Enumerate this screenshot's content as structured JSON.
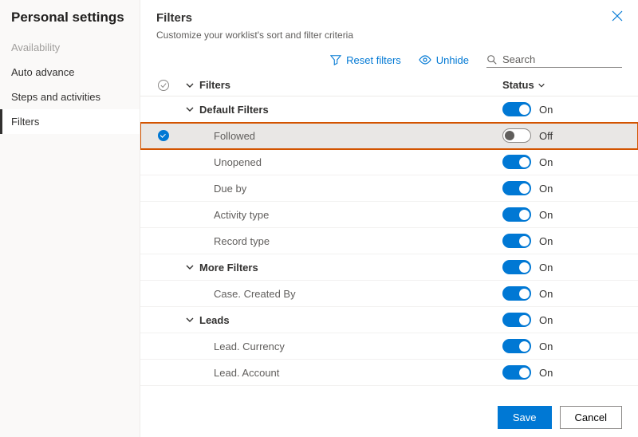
{
  "sidebar": {
    "title": "Personal settings",
    "items": [
      {
        "label": "Availability",
        "disabled": true
      },
      {
        "label": "Auto advance"
      },
      {
        "label": "Steps and activities"
      },
      {
        "label": "Filters",
        "selected": true
      }
    ]
  },
  "header": {
    "title": "Filters",
    "subtitle": "Customize your worklist's sort and filter criteria"
  },
  "toolbar": {
    "reset_label": "Reset filters",
    "unhide_label": "Unhide",
    "search_placeholder": "Search"
  },
  "columns": {
    "name": "Filters",
    "status": "Status"
  },
  "status_text": {
    "on": "On",
    "off": "Off"
  },
  "rows": [
    {
      "type": "group",
      "label": "Default Filters",
      "status": "on",
      "indent": 0,
      "caret": true
    },
    {
      "type": "item",
      "label": "Followed",
      "status": "off",
      "indent": 1,
      "selected": true,
      "highlight": true
    },
    {
      "type": "item",
      "label": "Unopened",
      "status": "on",
      "indent": 1
    },
    {
      "type": "item",
      "label": "Due by",
      "status": "on",
      "indent": 1
    },
    {
      "type": "item",
      "label": "Activity type",
      "status": "on",
      "indent": 1
    },
    {
      "type": "item",
      "label": "Record type",
      "status": "on",
      "indent": 1
    },
    {
      "type": "group",
      "label": "More Filters",
      "status": "on",
      "indent": 0,
      "caret": true
    },
    {
      "type": "item",
      "label": "Case. Created By",
      "status": "on",
      "indent": 1
    },
    {
      "type": "group",
      "label": "Leads",
      "status": "on",
      "indent": 0,
      "caret": true
    },
    {
      "type": "item",
      "label": "Lead. Currency",
      "status": "on",
      "indent": 1
    },
    {
      "type": "item",
      "label": "Lead. Account",
      "status": "on",
      "indent": 1
    }
  ],
  "footer": {
    "save": "Save",
    "cancel": "Cancel"
  }
}
